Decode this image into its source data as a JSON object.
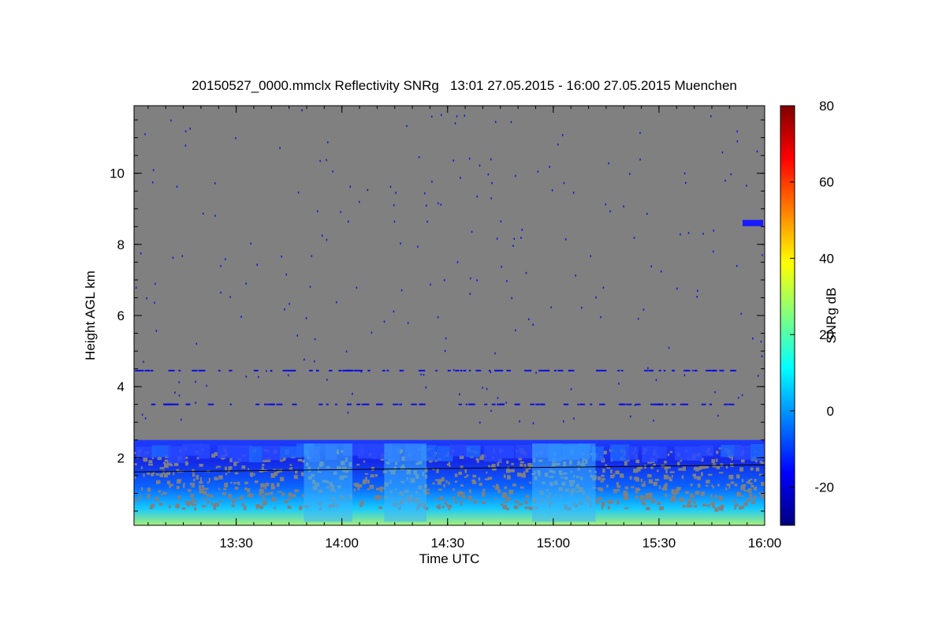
{
  "chart_data": {
    "type": "heatmap",
    "title": "20150527_0000.mmclx Reflectivity SNRg   13:01 27.05.2015 - 16:00 27.05.2015 Muenchen",
    "xlabel": "Time UTC",
    "ylabel": "Height AGL km",
    "x_tick_labels": [
      "13:30",
      "14:00",
      "14:30",
      "15:00",
      "15:30",
      "16:00"
    ],
    "xlim": [
      "13:01",
      "16:00"
    ],
    "y_ticks": [
      2,
      4,
      6,
      8,
      10
    ],
    "ylim": [
      0.1,
      11.9
    ],
    "colorbar": {
      "label": "SNRg dB",
      "ticks": [
        -20,
        0,
        20,
        40,
        60,
        80
      ],
      "range": [
        -30,
        80
      ],
      "colormap": "jet"
    },
    "background_color": "#808080",
    "features": {
      "boundary_layer_echo_top_km": 2.5,
      "strong_echo_band_km": [
        1.9,
        2.4
      ],
      "noise_lines_km": [
        4.45,
        3.5
      ],
      "reference_line_km": [
        1.6,
        1.8
      ],
      "upper_echo": {
        "time": "16:00",
        "height_km": 8.6
      }
    }
  }
}
